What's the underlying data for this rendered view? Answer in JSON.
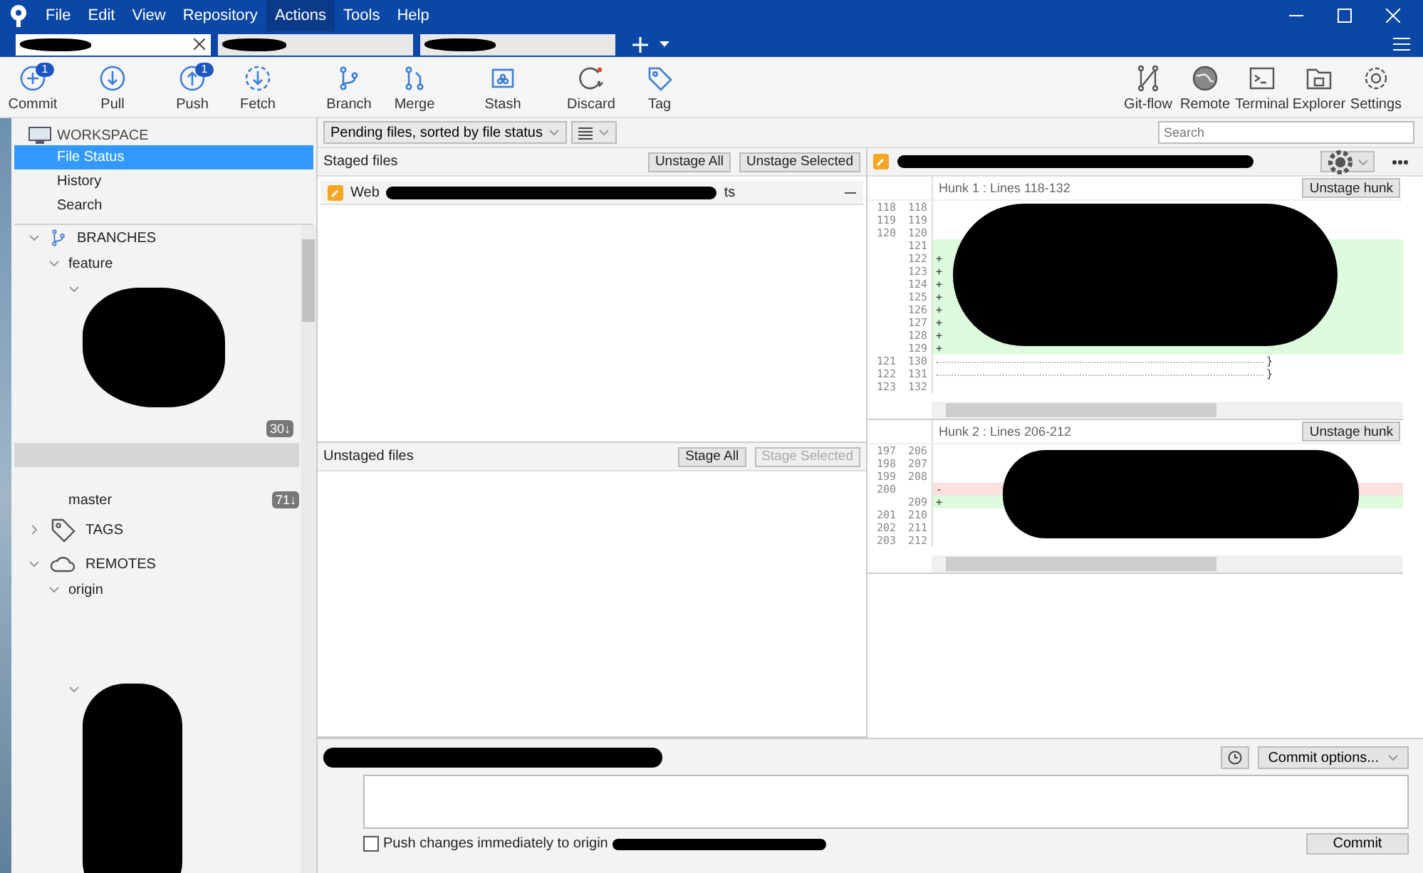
{
  "menu": [
    {
      "label": "File",
      "selected": false
    },
    {
      "label": "Edit",
      "selected": false
    },
    {
      "label": "View",
      "selected": false
    },
    {
      "label": "Repository",
      "selected": false
    },
    {
      "label": "Actions",
      "selected": true
    },
    {
      "label": "Tools",
      "selected": false
    },
    {
      "label": "Help",
      "selected": false
    }
  ],
  "tabs": [
    {
      "selected": true
    },
    {
      "selected": false
    },
    {
      "selected": false
    }
  ],
  "toolbar": [
    {
      "label": "Commit",
      "badge": "1"
    },
    {
      "label": "Pull"
    },
    {
      "label": "Push",
      "badge": "1"
    },
    {
      "label": "Fetch"
    },
    {
      "label": "Branch"
    },
    {
      "label": "Merge"
    },
    {
      "label": "Stash"
    },
    {
      "label": "Discard"
    },
    {
      "label": "Tag"
    }
  ],
  "toolbar_right": [
    {
      "label": "Git-flow"
    },
    {
      "label": "Remote"
    },
    {
      "label": "Terminal"
    },
    {
      "label": "Explorer"
    },
    {
      "label": "Settings"
    }
  ],
  "sidebar": {
    "workspace": {
      "title": "WORKSPACE",
      "items": [
        {
          "label": "File Status",
          "selected": true
        },
        {
          "label": "History",
          "selected": false
        },
        {
          "label": "Search",
          "selected": false
        }
      ]
    },
    "branches": {
      "title": "BRANCHES",
      "expanded": true,
      "items": [
        {
          "label": "feature",
          "expanded": true,
          "children": [
            {
              "badge": "30↓",
              "selected": false
            },
            {
              "selected": true
            }
          ]
        },
        {
          "label": "master",
          "badge": "71↓",
          "selected": false
        }
      ]
    },
    "tags": {
      "title": "TAGS",
      "expanded": false
    },
    "remotes": {
      "title": "REMOTES",
      "expanded": true,
      "items": [
        {
          "label": "origin",
          "expanded": true
        }
      ]
    }
  },
  "filter": {
    "value": "Pending files, sorted by file status"
  },
  "search": {
    "placeholder": "Search"
  },
  "staged": {
    "title": "Staged files",
    "buttons": [
      {
        "label": "Unstage All",
        "disabled": false
      },
      {
        "label": "Unstage Selected",
        "disabled": false
      }
    ],
    "files": [
      {
        "start": "Web",
        "end": "ts"
      }
    ]
  },
  "unstaged": {
    "title": "Unstaged files",
    "buttons": [
      {
        "label": "Stage All",
        "disabled": false
      },
      {
        "label": "Stage Selected",
        "disabled": true
      }
    ]
  },
  "diff": {
    "hunks": [
      {
        "title": "Hunk 1 : Lines 118-132",
        "button": "Unstage hunk",
        "lines": [
          {
            "old": "118",
            "new": "118",
            "kind": "context"
          },
          {
            "old": "119",
            "new": "119",
            "kind": "context"
          },
          {
            "old": "120",
            "new": "120",
            "kind": "context"
          },
          {
            "new": "121",
            "kind": "added"
          },
          {
            "new": "122",
            "kind": "added",
            "marker": "+"
          },
          {
            "new": "123",
            "kind": "added",
            "marker": "+"
          },
          {
            "new": "124",
            "kind": "added",
            "marker": "+"
          },
          {
            "new": "125",
            "kind": "added",
            "marker": "+"
          },
          {
            "new": "126",
            "kind": "added",
            "marker": "+"
          },
          {
            "new": "127",
            "kind": "added",
            "marker": "+"
          },
          {
            "new": "128",
            "kind": "added",
            "marker": "+"
          },
          {
            "new": "129",
            "kind": "added",
            "marker": "+"
          },
          {
            "old": "121",
            "new": "130",
            "kind": "context",
            "text": "}"
          },
          {
            "old": "122",
            "new": "131",
            "kind": "context",
            "text": "}"
          },
          {
            "old": "123",
            "new": "132",
            "kind": "context"
          }
        ]
      },
      {
        "title": "Hunk 2 : Lines 206-212",
        "button": "Unstage hunk",
        "lines": [
          {
            "old": "197",
            "new": "206",
            "kind": "context"
          },
          {
            "old": "198",
            "new": "207",
            "kind": "context"
          },
          {
            "old": "199",
            "new": "208",
            "kind": "context"
          },
          {
            "old": "200",
            "kind": "removed",
            "marker": "-"
          },
          {
            "new": "209",
            "kind": "added",
            "marker": "+"
          },
          {
            "old": "201",
            "new": "210",
            "kind": "context"
          },
          {
            "old": "202",
            "new": "211",
            "kind": "context"
          },
          {
            "old": "203",
            "new": "212",
            "kind": "context"
          }
        ]
      }
    ]
  },
  "commit": {
    "options": "Commit options...",
    "push": {
      "label": "Push changes immediately to origin",
      "checked": false
    },
    "button": "Commit"
  }
}
